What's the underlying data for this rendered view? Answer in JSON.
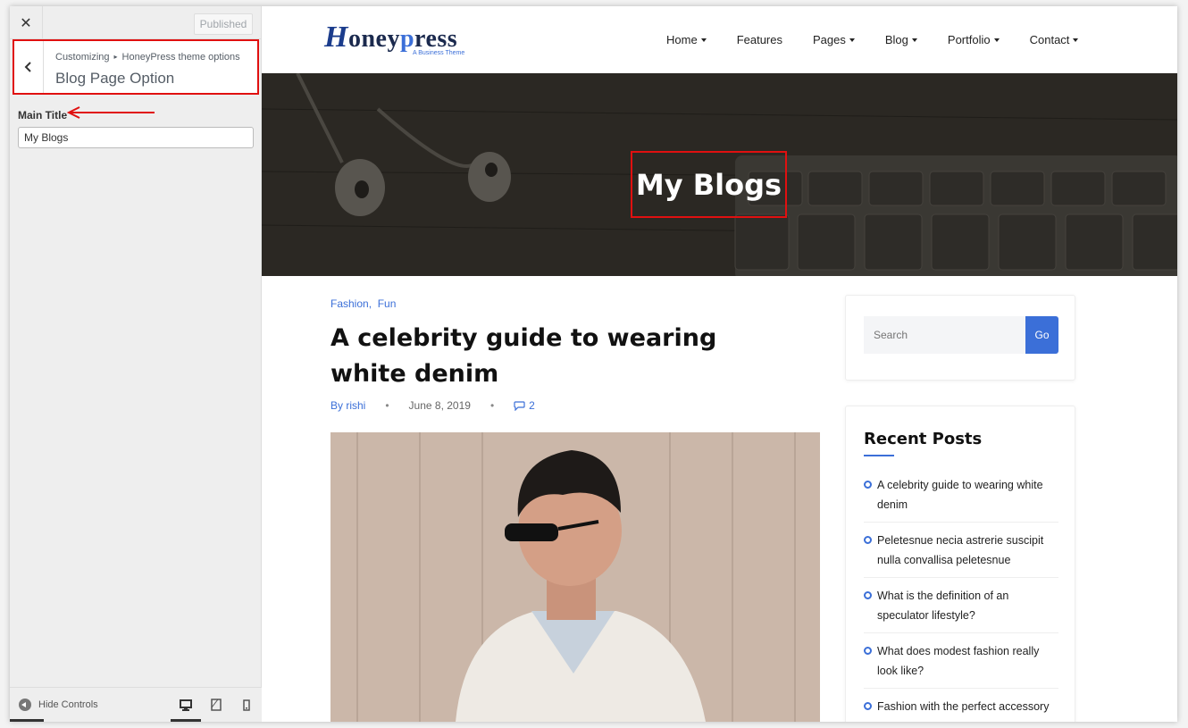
{
  "customizer": {
    "close_symbol": "✕",
    "publish_label": "Published",
    "breadcrumb": [
      "Customizing",
      "HoneyPress theme options"
    ],
    "section_title": "Blog Page Option",
    "field_label": "Main Title",
    "field_value": "My Blogs",
    "hide_controls_label": "Hide Controls",
    "devices": [
      "desktop-icon",
      "tablet-icon",
      "mobile-icon"
    ],
    "highlight_color": "#e01010"
  },
  "site": {
    "logo_initial": "H",
    "logo_mid": "oney",
    "logo_p": "p",
    "logo_rest": "ress",
    "logo_tagline": "A Business Theme",
    "nav": [
      {
        "label": "Home",
        "dropdown": true
      },
      {
        "label": "Features",
        "dropdown": false
      },
      {
        "label": "Pages",
        "dropdown": true
      },
      {
        "label": "Blog",
        "dropdown": true
      },
      {
        "label": "Portfolio",
        "dropdown": true
      },
      {
        "label": "Contact",
        "dropdown": true
      }
    ],
    "hero_title": "My Blogs",
    "post": {
      "categories": [
        "Fashion",
        "Fun"
      ],
      "title": "A celebrity guide to wearing white denim",
      "author": "By rishi",
      "date": "June 8, 2019",
      "comments": "2"
    },
    "search": {
      "placeholder": "Search",
      "button": "Go"
    },
    "recent_posts": {
      "title": "Recent Posts",
      "items": [
        "A celebrity guide to wearing white denim",
        "Peletesnue necia astrerie suscipit nulla convallisa peletesnue",
        "What is the definition of an speculator lifestyle?",
        "What does modest fashion really look like?",
        "Fashion with the perfect accessory"
      ]
    },
    "accent_color": "#3b6fd8"
  }
}
